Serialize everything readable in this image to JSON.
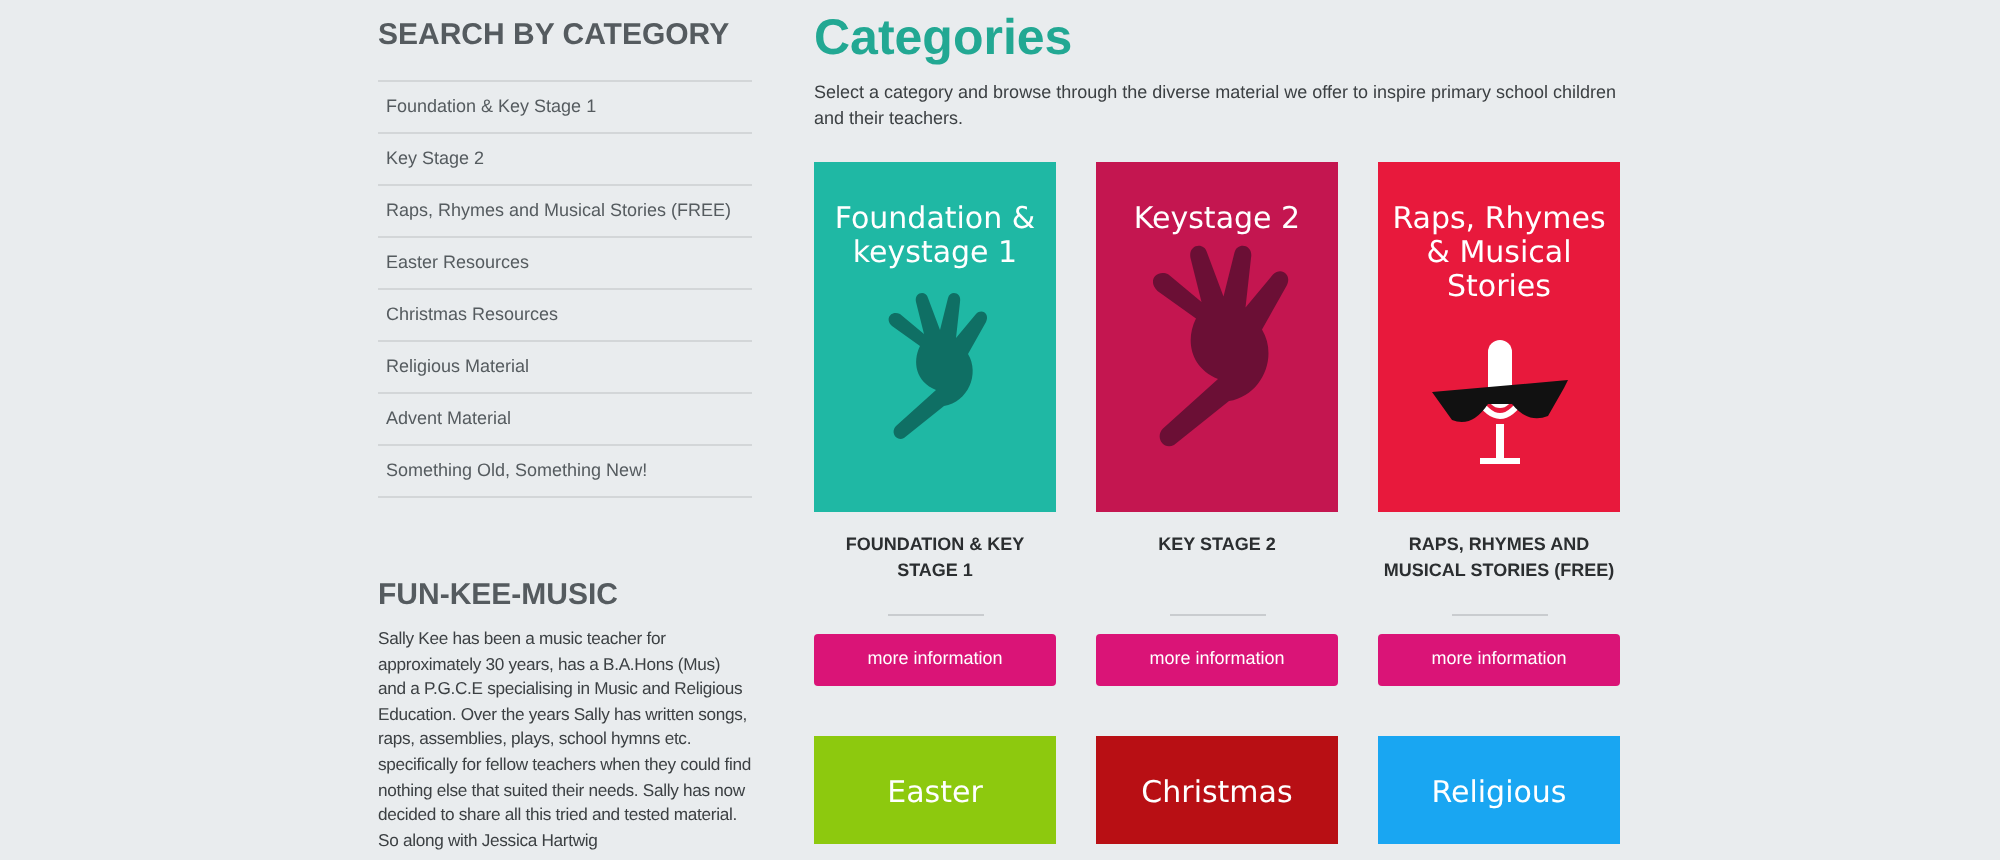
{
  "sidebar": {
    "category_heading": "SEARCH BY CATEGORY",
    "categories": [
      "Foundation & Key Stage 1",
      "Key Stage 2",
      "Raps, Rhymes and Musical Stories (FREE)",
      "Easter Resources",
      "Christmas Resources",
      "Religious Material",
      "Advent Material",
      "Something Old, Something New!"
    ],
    "about_heading": "FUN-KEE-MUSIC",
    "about_text": "Sally Kee has been a music teacher for approximately 30 years, has a B.A.Hons (Mus) and a P.G.C.E specialising in Music and Religious Education. Over the years Sally has written songs, raps, assemblies, plays, school hymns etc. specifically for fellow teachers when they could find nothing else that suited their needs. Sally has now decided to share all this tried and tested material. So along with Jessica Hartwig"
  },
  "main": {
    "title": "Categories",
    "intro": "Select a category and browse through the diverse material we offer to inspire primary school children and their teachers.",
    "cards": [
      {
        "kind": "hand",
        "color": "#1fb8a4",
        "cover_title": "Foundation & keystage 1",
        "title": "FOUNDATION & KEY STAGE 1",
        "button": "more information"
      },
      {
        "kind": "hand-large",
        "color": "#c41650",
        "cover_title": "Keystage 2",
        "title": "KEY STAGE 2",
        "button": "more information"
      },
      {
        "kind": "microphone",
        "color": "#e8193c",
        "cover_title": "Raps, Rhymes & Musical Stories",
        "title": "RAPS, RHYMES AND MUSICAL STORIES (FREE)",
        "button": "more information"
      },
      {
        "kind": "plain",
        "color": "#8dc90e",
        "cover_title": "Easter"
      },
      {
        "kind": "plain",
        "color": "#b80f14",
        "cover_title": "Christmas"
      },
      {
        "kind": "plain",
        "color": "#19a6f2",
        "cover_title": "Religious"
      }
    ]
  }
}
